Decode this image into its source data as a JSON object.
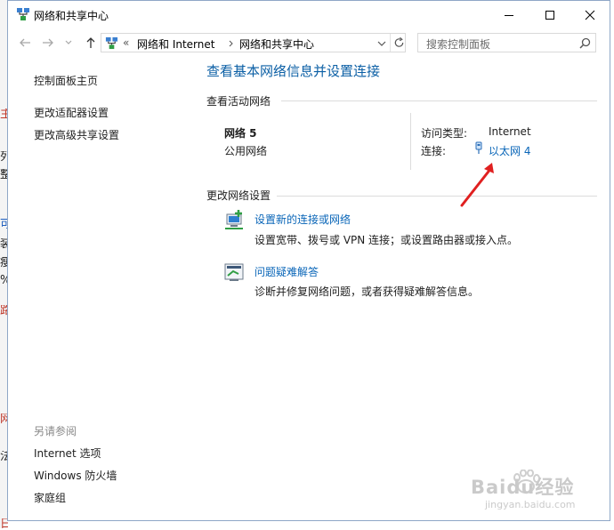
{
  "background_fragments": [
    "主",
    "列",
    "整",
    "可",
    "装",
    "瘦",
    "%",
    "路",
    "网",
    "法",
    "日"
  ],
  "window": {
    "title": "网络和共享中心"
  },
  "address": {
    "crumb_sep": "«",
    "crumbs": [
      "网络和 Internet",
      "网络和共享中心"
    ],
    "search_placeholder": "搜索控制面板"
  },
  "sidebar": {
    "home": "控制面板主页",
    "links": [
      "更改适配器设置",
      "更改高级共享设置"
    ],
    "see_also_heading": "另请参阅",
    "see_also": [
      "Internet 选项",
      "Windows 防火墙",
      "家庭组"
    ]
  },
  "main": {
    "title": "查看基本网络信息并设置连接",
    "active_heading": "查看活动网络",
    "network": {
      "name": "网络  5",
      "category": "公用网络",
      "access_label": "访问类型:",
      "access_value": "Internet",
      "conn_label": "连接:",
      "conn_value": "以太网 4"
    },
    "change_heading": "更改网络设置",
    "tasks": [
      {
        "title": "设置新的连接或网络",
        "desc": "设置宽带、拨号或 VPN 连接；或设置路由器或接入点。"
      },
      {
        "title": "问题疑难解答",
        "desc": "诊断并修复网络问题，或者获得疑难解答信息。"
      }
    ]
  },
  "watermark": {
    "brand": "Baidu经验",
    "url": "jingyan.baidu.com"
  },
  "colors": {
    "link": "#0a66b8",
    "title": "#0b5fa5",
    "arrow": "#e02020"
  }
}
